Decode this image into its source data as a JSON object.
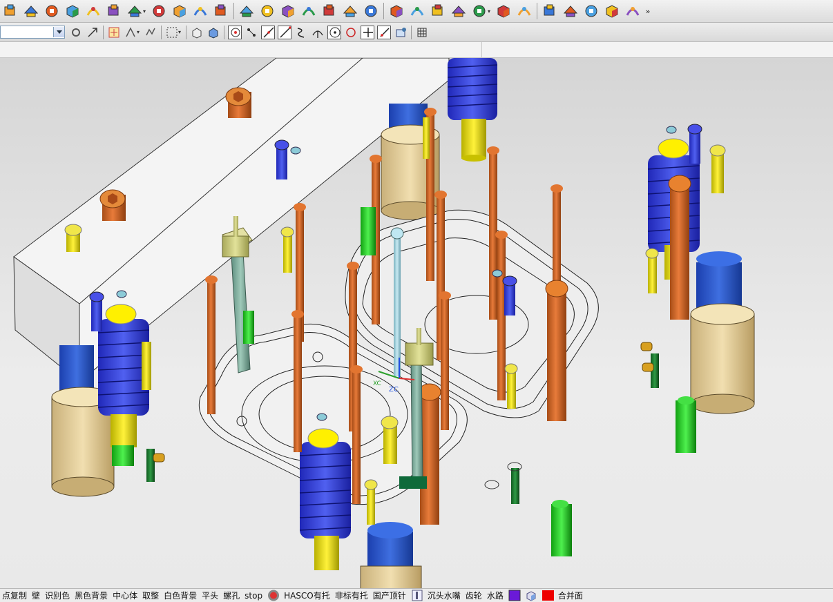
{
  "toolbar_top": {
    "icons": [
      "mold-wizard-icon",
      "layout-icon",
      "mold-base-icon",
      "standard-part-icon",
      "part-family-icon",
      "ejector-pin-icon",
      "slider-lifter-icon",
      "sub-insert-icon",
      "electrode-icon",
      "trim-icon",
      "pocket-icon",
      "bom-icon",
      "drawing-icon",
      "cooling-icon",
      "surface-icon",
      "box-icon",
      "sheet-icon",
      "extrude-icon",
      "shell-icon",
      "analysis-icon",
      "view-icon",
      "mesh-icon",
      "blend-icon",
      "split-icon",
      "replace-icon",
      "offset-icon",
      "unite-icon",
      "subtract-icon",
      "measure-icon",
      "wrench-icon"
    ],
    "overflow": "»"
  },
  "toolbar_second": {
    "combo_value": "",
    "icons": [
      "snap-icon",
      "move-icon",
      "select-filter-icon",
      "transform-icon",
      "copy-icon",
      "rect-select-icon",
      "wireframe-icon",
      "shaded-icon",
      "snap-point-icon",
      "snap-end-icon",
      "line-icon",
      "line-2-icon",
      "curve-icon",
      "intersect-icon",
      "circle-center-icon",
      "quadrant-icon",
      "plus-icon",
      "line-3-icon",
      "view-triad-icon",
      "grid-icon"
    ]
  },
  "viewport": {
    "axis_label_zc": "ZC",
    "axis_label_xc": "XC"
  },
  "bottom_bar": {
    "items": [
      "点复制",
      "壁",
      "识别色",
      "黑色背景",
      "中心体",
      "取整",
      "白色背景",
      "平头",
      "螺孔",
      "stop"
    ],
    "items2": [
      "HASCO有托",
      "非标有托",
      "国产顶针"
    ],
    "items3": [
      "沉头水嘴",
      "齿轮",
      "水路"
    ],
    "items4": [
      "合并面"
    ],
    "colors": {
      "purple": "#6a1ad8",
      "red": "#ee0000"
    }
  }
}
